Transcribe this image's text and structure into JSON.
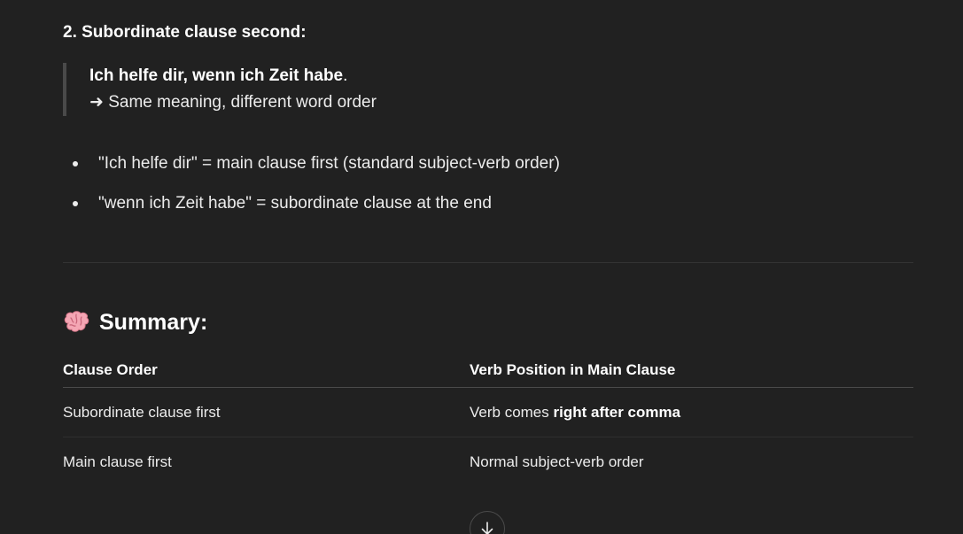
{
  "section": {
    "heading": "2. Subordinate clause second:"
  },
  "quote": {
    "example_bold": "Ich helfe dir, wenn ich Zeit habe",
    "example_period": ".",
    "note": "➜ Same meaning, different word order"
  },
  "bullets": [
    "\"Ich helfe dir\" = main clause first (standard subject-verb order)",
    "\"wenn ich Zeit habe\" = subordinate clause at the end"
  ],
  "summary": {
    "icon": "brain-icon",
    "heading": "Summary:"
  },
  "table": {
    "headers": [
      "Clause Order",
      "Verb Position in Main Clause"
    ],
    "rows": [
      {
        "col1": "Subordinate clause first",
        "col2_prefix": "Verb comes ",
        "col2_bold": "right after comma"
      },
      {
        "col1": "Main clause first",
        "col2_prefix": "Normal subject-verb order",
        "col2_bold": ""
      }
    ]
  },
  "scroll_button": {
    "icon": "arrow-down-icon"
  },
  "colors": {
    "background": "#212121",
    "text": "#ececec",
    "heading": "#ffffff",
    "quote_bar": "#4a4a4a",
    "divider": "#333333",
    "brain": "#f4a6b4"
  }
}
